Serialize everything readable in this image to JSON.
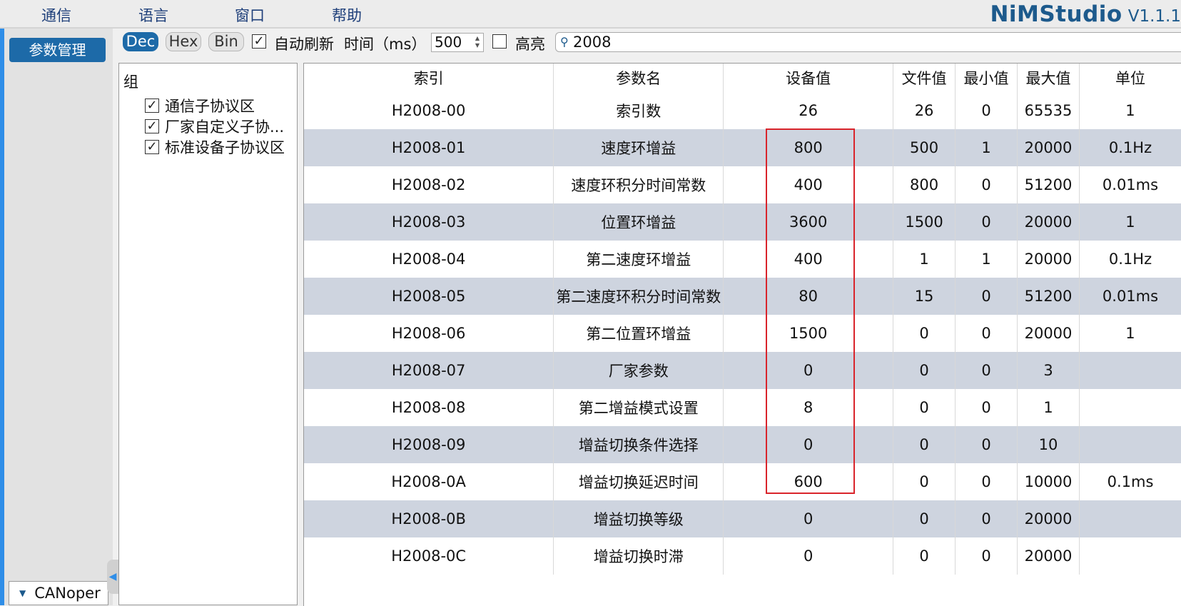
{
  "menu": {
    "items": [
      "通信",
      "语言",
      "窗口",
      "帮助"
    ],
    "brand_name": "NiMStudio",
    "brand_version": "V1.1.1"
  },
  "nav": {
    "active_label": "参数管理",
    "bottom_label": "CANoper"
  },
  "toolbar": {
    "format_buttons": [
      "Dec",
      "Hex",
      "Bin"
    ],
    "active_format": "Dec",
    "auto_refresh_label": "自动刷新",
    "auto_refresh_checked": true,
    "time_label": "时间（ms）",
    "time_value": "500",
    "highlight_label": "高亮",
    "highlight_checked": false,
    "search_value": "2008"
  },
  "groups": {
    "title": "组",
    "items": [
      {
        "label": "通信子协议区",
        "checked": true
      },
      {
        "label": "厂家自定义子协...",
        "checked": true
      },
      {
        "label": "标准设备子协议区",
        "checked": true
      }
    ]
  },
  "table": {
    "headers": [
      "索引",
      "参数名",
      "设备值",
      "文件值",
      "最小值",
      "最大值",
      "单位"
    ],
    "rows": [
      [
        "H2008-00",
        "索引数",
        "26",
        "26",
        "0",
        "65535",
        "1"
      ],
      [
        "H2008-01",
        "速度环增益",
        "800",
        "500",
        "1",
        "20000",
        "0.1Hz"
      ],
      [
        "H2008-02",
        "速度环积分时间常数",
        "400",
        "800",
        "0",
        "51200",
        "0.01ms"
      ],
      [
        "H2008-03",
        "位置环增益",
        "3600",
        "1500",
        "0",
        "20000",
        "1"
      ],
      [
        "H2008-04",
        "第二速度环增益",
        "400",
        "1",
        "1",
        "20000",
        "0.1Hz"
      ],
      [
        "H2008-05",
        "第二速度环积分时间常数",
        "80",
        "15",
        "0",
        "51200",
        "0.01ms"
      ],
      [
        "H2008-06",
        "第二位置环增益",
        "1500",
        "0",
        "0",
        "20000",
        "1"
      ],
      [
        "H2008-07",
        "厂家参数",
        "0",
        "0",
        "0",
        "3",
        ""
      ],
      [
        "H2008-08",
        "第二增益模式设置",
        "8",
        "0",
        "0",
        "1",
        ""
      ],
      [
        "H2008-09",
        "增益切换条件选择",
        "0",
        "0",
        "0",
        "10",
        ""
      ],
      [
        "H2008-0A",
        "增益切换延迟时间",
        "600",
        "0",
        "0",
        "10000",
        "0.1ms"
      ],
      [
        "H2008-0B",
        "增益切换等级",
        "0",
        "0",
        "0",
        "20000",
        ""
      ],
      [
        "H2008-0C",
        "增益切换时滞",
        "0",
        "0",
        "0",
        "20000",
        ""
      ]
    ],
    "highlighted_rows": [
      "H2008-01",
      "H2008-0A"
    ],
    "highlight_color": "#d9242b"
  },
  "colors": {
    "accent": "#2f8ee8",
    "brand": "#1d5a8c",
    "active_button": "#1d6aa8",
    "row_alt": "#ced4df"
  }
}
